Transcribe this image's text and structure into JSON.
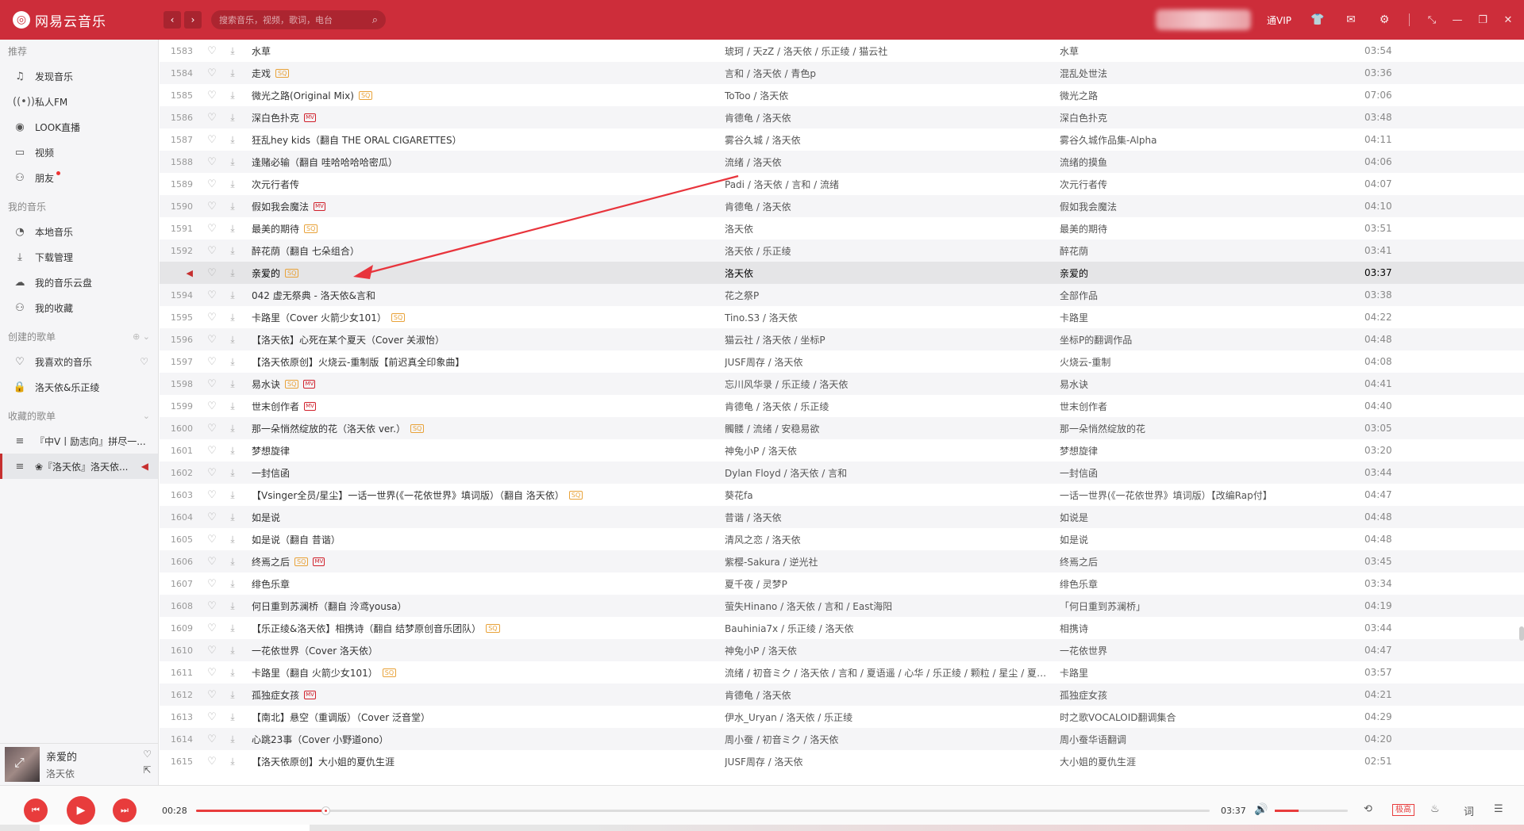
{
  "app": {
    "logo_text": "网易云音乐",
    "search_placeholder": "搜索音乐，视频，歌词，电台",
    "vip_text": "通VIP"
  },
  "sidebar": {
    "sections": [
      {
        "title": "推荐",
        "items": [
          {
            "label": "发现音乐",
            "icon": "music-note-icon"
          },
          {
            "label": "私人FM",
            "icon": "radio-icon"
          },
          {
            "label": "LOOK直播",
            "icon": "live-icon"
          },
          {
            "label": "视频",
            "icon": "video-icon"
          },
          {
            "label": "朋友",
            "icon": "friends-icon"
          }
        ]
      },
      {
        "title": "我的音乐",
        "items": [
          {
            "label": "本地音乐",
            "icon": "local-music-icon"
          },
          {
            "label": "下载管理",
            "icon": "download-icon"
          },
          {
            "label": "我的音乐云盘",
            "icon": "cloud-icon"
          },
          {
            "label": "我的收藏",
            "icon": "collection-icon"
          }
        ]
      },
      {
        "title": "创建的歌单",
        "items": [
          {
            "label": "我喜欢的音乐",
            "icon": "heart-icon"
          },
          {
            "label": "洛天依&乐正绫",
            "icon": "lock-icon"
          }
        ]
      },
      {
        "title": "收藏的歌单",
        "items": [
          {
            "label": "『中V丨励志向』拼尽一...",
            "icon": "playlist-icon"
          },
          {
            "label": "❀『洛天依』洛天依...",
            "icon": "playlist-icon"
          }
        ]
      }
    ]
  },
  "now_playing": {
    "title": "亲爱的",
    "artist": "洛天依",
    "current_time": "00:28",
    "total_time": "03:37",
    "progress": 0.128,
    "volume": 0.33,
    "quality": "极高"
  },
  "songs": [
    {
      "idx": "1583",
      "title": "水草",
      "badges": [],
      "artist": "琥珂 / 天zZ / 洛天依 / 乐正绫 / 猫云社",
      "album": "水草",
      "duration": "03:54"
    },
    {
      "idx": "1584",
      "title": "走戏",
      "badges": [
        "SQ"
      ],
      "artist": "言和 / 洛天依 / 青色p",
      "album": "混乱处世法",
      "duration": "03:36"
    },
    {
      "idx": "1585",
      "title": "微光之路(Original Mix)",
      "badges": [
        "SQ"
      ],
      "artist": "ToToo / 洛天依",
      "album": "微光之路",
      "duration": "07:06"
    },
    {
      "idx": "1586",
      "title": "深白色扑克",
      "badges": [
        "MV"
      ],
      "artist": "肯德龟 / 洛天依",
      "album": "深白色扑克",
      "duration": "03:48"
    },
    {
      "idx": "1587",
      "title": "狂乱hey kids（翻自 THE ORAL CIGARETTES）",
      "badges": [],
      "artist": "雾谷久城 / 洛天依",
      "album": "雾谷久城作品集-Alpha",
      "duration": "04:11"
    },
    {
      "idx": "1588",
      "title": "逢赌必输（翻自 哇哈哈哈哈密瓜）",
      "badges": [],
      "artist": "流绪 / 洛天依",
      "album": "流绪的摸鱼",
      "duration": "04:06"
    },
    {
      "idx": "1589",
      "title": "次元行者传",
      "badges": [],
      "artist": "Padi / 洛天依 / 言和 / 流绪",
      "album": "次元行者传",
      "duration": "04:07"
    },
    {
      "idx": "1590",
      "title": "假如我会魔法",
      "badges": [
        "MV"
      ],
      "artist": "肯德龟 / 洛天依",
      "album": "假如我会魔法",
      "duration": "04:10"
    },
    {
      "idx": "1591",
      "title": "最美的期待",
      "badges": [
        "SQ"
      ],
      "artist": "洛天依",
      "album": "最美的期待",
      "duration": "03:51"
    },
    {
      "idx": "1592",
      "title": "醉花荫（翻自 七朵组合）",
      "badges": [],
      "artist": "洛天依 / 乐正绫",
      "album": "醉花荫",
      "duration": "03:41"
    },
    {
      "idx": "",
      "title": "亲爱的",
      "badges": [
        "SQ"
      ],
      "artist": "洛天依",
      "album": "亲爱的",
      "duration": "03:37",
      "playing": true
    },
    {
      "idx": "1594",
      "title": "042 虚无祭典 - 洛天依&言和",
      "badges": [],
      "artist": "花之祭P",
      "album": "全部作品",
      "duration": "03:38"
    },
    {
      "idx": "1595",
      "title": "卡路里（Cover 火箭少女101）",
      "badges": [
        "SQ"
      ],
      "artist": "Tino.S3 / 洛天依",
      "album": "卡路里",
      "duration": "04:22"
    },
    {
      "idx": "1596",
      "title": "【洛天依】心死在某个夏天（Cover 关淑怡）",
      "badges": [],
      "artist": "猫云社 / 洛天依 / 坐标P",
      "album": "坐标P的翻调作品",
      "duration": "04:48"
    },
    {
      "idx": "1597",
      "title": "【洛天依原创】火烧云-重制版【前迟真全印象曲】",
      "badges": [],
      "artist": "JUSF周存 / 洛天依",
      "album": "火烧云-重制",
      "duration": "04:08"
    },
    {
      "idx": "1598",
      "title": "易水诀",
      "badges": [
        "SQ",
        "MV"
      ],
      "artist": "忘川风华录 / 乐正绫 / 洛天依",
      "album": "易水诀",
      "duration": "04:41"
    },
    {
      "idx": "1599",
      "title": "世末创作者",
      "badges": [
        "MV"
      ],
      "artist": "肯德龟 / 洛天依 / 乐正绫",
      "album": "世末创作者",
      "duration": "04:40"
    },
    {
      "idx": "1600",
      "title": "那一朵悄然绽放的花（洛天依 ver.）",
      "badges": [
        "SQ"
      ],
      "artist": "髑髅 / 流绪 / 安稳易欲",
      "album": "那一朵悄然绽放的花",
      "duration": "03:05"
    },
    {
      "idx": "1601",
      "title": "梦想旋律",
      "badges": [],
      "artist": "神兔小P / 洛天依",
      "album": "梦想旋律",
      "duration": "03:20"
    },
    {
      "idx": "1602",
      "title": "一封信函",
      "badges": [],
      "artist": "Dylan Floyd / 洛天依 / 言和",
      "album": "一封信函",
      "duration": "03:44"
    },
    {
      "idx": "1603",
      "title": "【Vsinger全员/星尘】一话一世界(《一花依世界》填词版）（翻自 洛天依）",
      "badges": [
        "SQ"
      ],
      "artist": "葵花fa",
      "album": "一话一世界(《一花依世界》填词版）【改编Rap付】",
      "duration": "04:47"
    },
    {
      "idx": "1604",
      "title": "如是说",
      "badges": [],
      "artist": "昔谐 / 洛天依",
      "album": "如说是",
      "duration": "04:48"
    },
    {
      "idx": "1605",
      "title": "如是说（翻自 昔谐）",
      "badges": [],
      "artist": "清风之恋 / 洛天依",
      "album": "如是说",
      "duration": "04:48"
    },
    {
      "idx": "1606",
      "title": "终焉之后",
      "badges": [
        "SQ",
        "MV"
      ],
      "artist": "紫樱-Sakura / 逆光社",
      "album": "终焉之后",
      "duration": "03:45"
    },
    {
      "idx": "1607",
      "title": "绯色乐章",
      "badges": [],
      "artist": "夏千夜 / 灵梦P",
      "album": "绯色乐章",
      "duration": "03:34"
    },
    {
      "idx": "1608",
      "title": "何日重到苏澜桥（翻自 泠鸢yousa）",
      "badges": [],
      "artist": "萤失Hinano / 洛天依 / 言和 / East海阳",
      "album": "「何日重到苏澜桥」",
      "duration": "04:19"
    },
    {
      "idx": "1609",
      "title": "【乐正绫&洛天依】相携诗（翻自 结梦原创音乐团队）",
      "badges": [
        "SQ"
      ],
      "artist": "Bauhinia7x / 乐正绫 / 洛天依",
      "album": "相携诗",
      "duration": "03:44"
    },
    {
      "idx": "1610",
      "title": "一花依世界（Cover 洛天依）",
      "badges": [],
      "artist": "神兔小P / 洛天依",
      "album": "一花依世界",
      "duration": "04:47"
    },
    {
      "idx": "1611",
      "title": "卡路里（翻自 火箭少女101）",
      "badges": [
        "SQ"
      ],
      "artist": "流绪 / 初音ミク / 洛天依 / 言和 / 夏语遥 / 心华 / 乐正绫 / 颗粒 / 星尘 / 夏宇 / ...",
      "album": "卡路里",
      "duration": "03:57"
    },
    {
      "idx": "1612",
      "title": "孤独症女孩",
      "badges": [
        "MV"
      ],
      "artist": "肯德龟 / 洛天依",
      "album": "孤独症女孩",
      "duration": "04:21"
    },
    {
      "idx": "1613",
      "title": "【南北】悬空（重调版）（Cover 泛音堂）",
      "badges": [],
      "artist": "伊水_Uryan / 洛天依 / 乐正绫",
      "album": "时之歌VOCALOID翻调集合",
      "duration": "04:29"
    },
    {
      "idx": "1614",
      "title": "心跳23事（Cover 小野道ono）",
      "badges": [],
      "artist": "周小蚕 / 初音ミク / 洛天依",
      "album": "周小蚕华语翻调",
      "duration": "04:20"
    },
    {
      "idx": "1615",
      "title": "【洛天依原创】大小姐的夏仇生涯",
      "badges": [],
      "artist": "JUSF周存 / 洛天依",
      "album": "大小姐的夏仇生涯",
      "duration": "02:51"
    }
  ],
  "colors": {
    "brand": "#cd2d3a",
    "accent": "#e83c3c",
    "sq_badge": "#e8a239",
    "mv_badge": "#d0202b"
  }
}
